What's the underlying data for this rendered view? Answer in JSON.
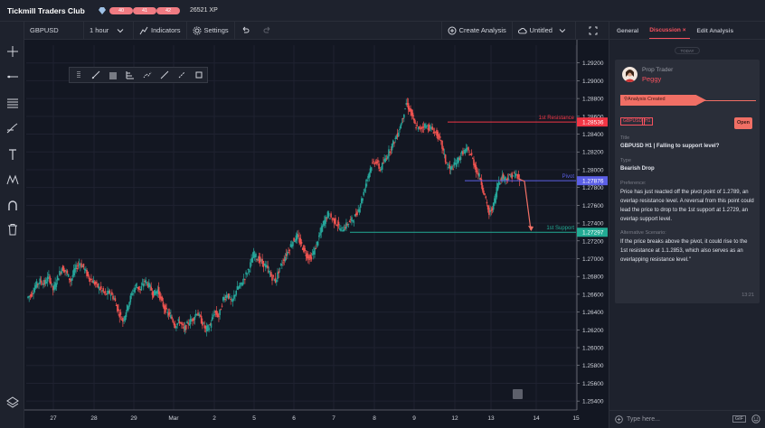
{
  "app": {
    "title": "Tickmill Traders Club",
    "xp_levels": [
      "40",
      "41",
      "42"
    ],
    "xp_text": "26521 XP"
  },
  "toolbar": {
    "symbol": "GBPUSD",
    "interval": "1 hour",
    "indicators_label": "Indicators",
    "settings_label": "Settings",
    "create_analysis_label": "Create Analysis",
    "untitled_label": "Untitled"
  },
  "left_tools": [
    "crosshair-icon",
    "horizontal-line-icon",
    "fib-retracement-icon",
    "brush-icon",
    "text-icon",
    "pattern-icon",
    "magnet-icon",
    "trash-icon",
    "layers-icon"
  ],
  "draw_tools": [
    "drag-handle-icon",
    "ray-icon",
    "parallel-channel-icon",
    "pitchfork-icon",
    "path-icon",
    "trend-line-icon",
    "info-line-icon",
    "rectangle-icon"
  ],
  "chart_data": {
    "type": "candlestick",
    "symbol": "GBPUSD",
    "ylim": [
      1.253,
      1.294
    ],
    "y_ticks": [
      "1.29200",
      "1.29000",
      "1.28800",
      "1.28600",
      "1.28400",
      "1.28200",
      "1.28000",
      "1.27800",
      "1.27600",
      "1.27400",
      "1.27200",
      "1.27000",
      "1.26800",
      "1.26600",
      "1.26400",
      "1.26200",
      "1.26000",
      "1.25800",
      "1.25600",
      "1.25400"
    ],
    "x_ticks": [
      "27",
      "28",
      "29",
      "Mar",
      "2",
      "5",
      "6",
      "7",
      "8",
      "9",
      "12",
      "13",
      "14",
      "15"
    ],
    "close_path": [
      1.266,
      1.267,
      1.2675,
      1.2672,
      1.268,
      1.2665,
      1.2678,
      1.269,
      1.2685,
      1.2675,
      1.2688,
      1.2695,
      1.269,
      1.268,
      1.2675,
      1.267,
      1.2665,
      1.266,
      1.2662,
      1.2655,
      1.264,
      1.263,
      1.2645,
      1.266,
      1.267,
      1.2665,
      1.2675,
      1.267,
      1.266,
      1.2665,
      1.265,
      1.264,
      1.2635,
      1.2625,
      1.263,
      1.262,
      1.2628,
      1.2632,
      1.264,
      1.263,
      1.262,
      1.2625,
      1.264,
      1.2635,
      1.2655,
      1.266,
      1.265,
      1.2665,
      1.267,
      1.268,
      1.269,
      1.2705,
      1.27,
      1.2695,
      1.269,
      1.268,
      1.2675,
      1.269,
      1.27,
      1.271,
      1.272,
      1.2725,
      1.2715,
      1.2705,
      1.27,
      1.271,
      1.2725,
      1.274,
      1.275,
      1.2745,
      1.274,
      1.2732,
      1.2736,
      1.2742,
      1.2745,
      1.2755,
      1.277,
      1.279,
      1.2805,
      1.281,
      1.28,
      1.281,
      1.282,
      1.283,
      1.284,
      1.2855,
      1.2875,
      1.2865,
      1.285,
      1.2845,
      1.285,
      1.2848,
      1.2845,
      1.284,
      1.283,
      1.281,
      1.28,
      1.2805,
      1.2812,
      1.282,
      1.2822,
      1.2815,
      1.28,
      1.279,
      1.277,
      1.275,
      1.276,
      1.2785,
      1.2792,
      1.279,
      1.2793,
      1.2795,
      1.2788
    ],
    "levels": [
      {
        "label": "1st Resistance",
        "value": 1.28536,
        "tag": "1.28536",
        "color": "#f23645"
      },
      {
        "label": "Pivot",
        "value": 1.27876,
        "tag": "1.27876",
        "color": "#5b5fe6"
      },
      {
        "label": "1st Support",
        "value": 1.27297,
        "tag": "1.27297",
        "color": "#22ab94"
      }
    ],
    "arrow": {
      "from": 1.2787,
      "to": 1.2732,
      "color": "#f06f65"
    }
  },
  "panel": {
    "tabs": [
      "General",
      "Discussion",
      "Edit Analysis"
    ],
    "active_tab": "Discussion",
    "today_label": "TODAY",
    "author_role": "Prop Trader",
    "author_name": "Peggy",
    "status_banner": "Analysis Created",
    "tags": [
      "GBPUSD",
      "H1"
    ],
    "open_label": "Open",
    "title_label": "Title",
    "title_value": "GBPUSD H1 | Falling to support level?",
    "type_label": "Type",
    "type_value": "Bearish Drop",
    "pref_label": "Preference:",
    "pref_value": "Price has just reacted off the  pivot point of 1.2789,  an overlap resistance level. A reversal from this point could lead the price to drop to the 1st support at 1.2729, an overlap support level.",
    "alt_label": "Alternative Scenario:",
    "alt_value": "If the price breaks above the pivot, it could  rise to the 1st resistance at 1.1.2853, which also serves as an overlapping resistance level.\"",
    "time": "13:21",
    "input_placeholder": "Type here...",
    "gif_label": "GIF"
  }
}
